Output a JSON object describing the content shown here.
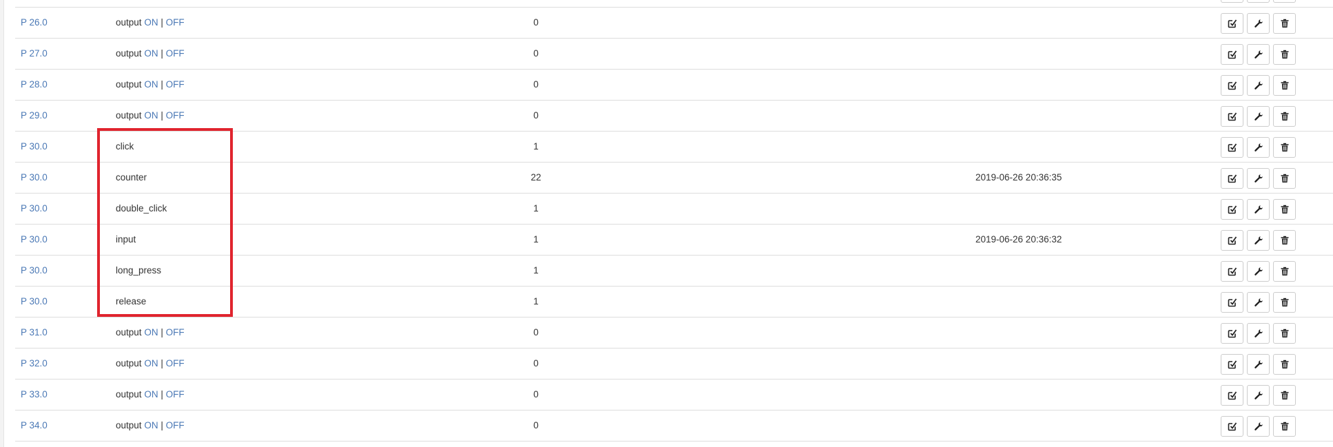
{
  "rows": [
    {
      "device": "P 26.0",
      "name": "output",
      "on": "ON",
      "sep": "|",
      "off": "OFF",
      "value": "0",
      "time": ""
    },
    {
      "device": "P 27.0",
      "name": "output",
      "on": "ON",
      "sep": "|",
      "off": "OFF",
      "value": "0",
      "time": ""
    },
    {
      "device": "P 28.0",
      "name": "output",
      "on": "ON",
      "sep": "|",
      "off": "OFF",
      "value": "0",
      "time": ""
    },
    {
      "device": "P 29.0",
      "name": "output",
      "on": "ON",
      "sep": "|",
      "off": "OFF",
      "value": "0",
      "time": ""
    },
    {
      "device": "P 30.0",
      "name": "click",
      "value": "1",
      "time": ""
    },
    {
      "device": "P 30.0",
      "name": "counter",
      "value": "22",
      "time": "2019-06-26 20:36:35"
    },
    {
      "device": "P 30.0",
      "name": "double_click",
      "value": "1",
      "time": ""
    },
    {
      "device": "P 30.0",
      "name": "input",
      "value": "1",
      "time": "2019-06-26 20:36:32"
    },
    {
      "device": "P 30.0",
      "name": "long_press",
      "value": "1",
      "time": ""
    },
    {
      "device": "P 30.0",
      "name": "release",
      "value": "1",
      "time": ""
    },
    {
      "device": "P 31.0",
      "name": "output",
      "on": "ON",
      "sep": "|",
      "off": "OFF",
      "value": "0",
      "time": ""
    },
    {
      "device": "P 32.0",
      "name": "output",
      "on": "ON",
      "sep": "|",
      "off": "OFF",
      "value": "0",
      "time": ""
    },
    {
      "device": "P 33.0",
      "name": "output",
      "on": "ON",
      "sep": "|",
      "off": "OFF",
      "value": "0",
      "time": ""
    },
    {
      "device": "P 34.0",
      "name": "output",
      "on": "ON",
      "sep": "|",
      "off": "OFF",
      "value": "0",
      "time": ""
    }
  ],
  "actions": [
    {
      "icon": "edit-check-icon"
    },
    {
      "icon": "wrench-icon"
    },
    {
      "icon": "trash-icon"
    }
  ],
  "colors": {
    "link": "#4a78b5",
    "highlight": "#e0242e",
    "border": "#dddddd"
  }
}
